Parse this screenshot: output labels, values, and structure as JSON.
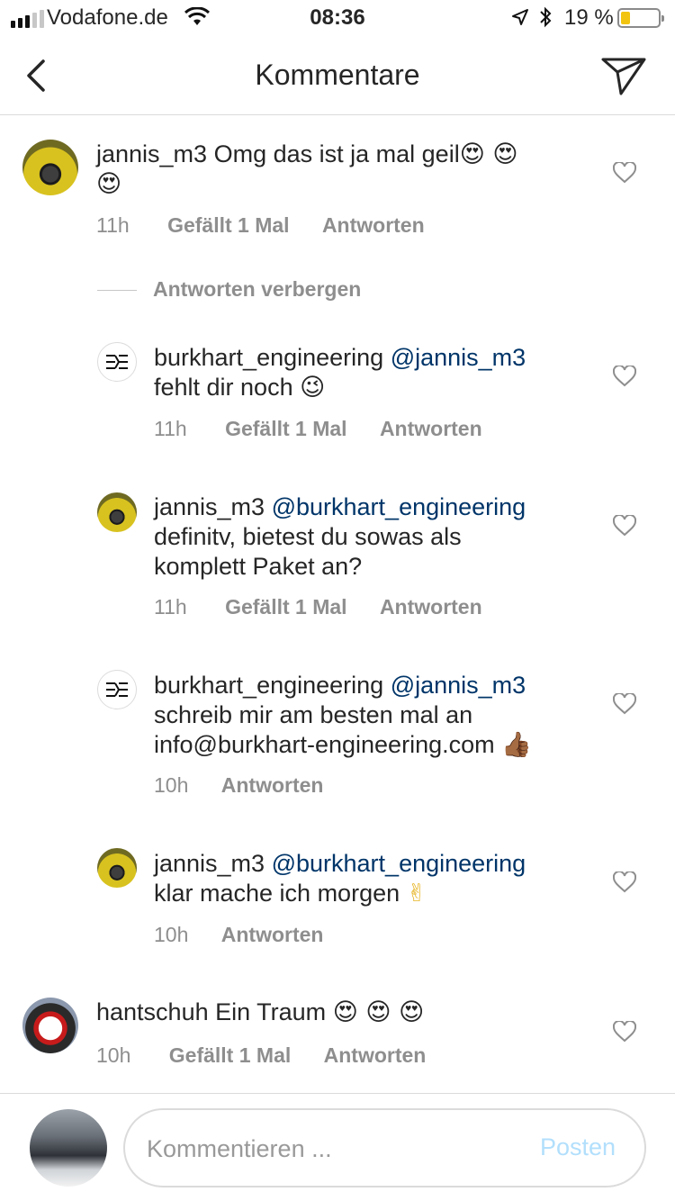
{
  "status_bar": {
    "carrier": "Vodafone.de",
    "time": "08:36",
    "battery_percent": "19 %",
    "battery_level": 0.19,
    "signal_bars_filled": 3,
    "signal_bars_total": 5
  },
  "header": {
    "title": "Kommentare"
  },
  "comments": [
    {
      "username": "jannis_m3",
      "line1": "Omg das ist ja mal geil",
      "line1_emoji": "😍 😍",
      "line2_emoji": "😍",
      "time": "11h",
      "likes": "Gefällt 1 Mal",
      "reply": "Antworten"
    },
    {
      "hide_replies": "Antworten verbergen"
    },
    {
      "username": "burkhart_engineering",
      "mention": "@jannis_m3",
      "line2": "fehlt dir noch",
      "line2_emoji": "😉",
      "time": "11h",
      "likes": "Gefällt 1 Mal",
      "reply": "Antworten"
    },
    {
      "username": "jannis_m3",
      "mention": "@burkhart_engineering",
      "line2": "definitv, bietest du sowas als",
      "line3": "komplett Paket an?",
      "time": "11h",
      "likes": "Gefällt 1 Mal",
      "reply": "Antworten"
    },
    {
      "username": "burkhart_engineering",
      "mention": "@jannis_m3",
      "line2": "schreib mir am besten mal an",
      "line3": "info@burkhart-engineering.com",
      "line3_emoji": "👍🏾",
      "time": "10h",
      "reply": "Antworten"
    },
    {
      "username": "jannis_m3",
      "mention": "@burkhart_engineering",
      "line2": "klar mache ich morgen",
      "line2_emoji": "✌",
      "time": "10h",
      "reply": "Antworten"
    },
    {
      "username": "hantschuh",
      "line1": "Ein Traum",
      "line1_emoji": "😍 😍 😍",
      "time": "10h",
      "likes": "Gefällt 1 Mal",
      "reply": "Antworten"
    }
  ],
  "composer": {
    "placeholder": "Kommentieren ...",
    "post_label": "Posten"
  },
  "colors": {
    "mention": "#003569",
    "meta": "#8e8e8e",
    "post_disabled": "#b2dffc",
    "battery": "#f2c40f"
  },
  "icons": {
    "back": "chevron-left-icon",
    "send": "paper-plane-icon",
    "like": "heart-outline-icon"
  }
}
